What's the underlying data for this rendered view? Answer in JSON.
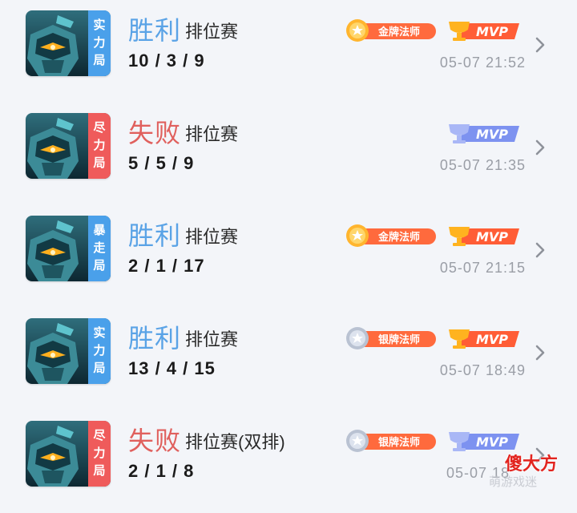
{
  "matches": [
    {
      "mode": [
        "实",
        "力",
        "局"
      ],
      "mode_color": "#4aa0ea",
      "result": "胜利",
      "result_color": "#5aa3e6",
      "game_type": "排位赛",
      "kda": "10 / 3 / 9",
      "medal": "金牌法师",
      "medal_tier": "gold",
      "mvp": "MVP",
      "mvp_tier": "gold",
      "time": "05-07 21:52"
    },
    {
      "mode": [
        "尽",
        "力",
        "局"
      ],
      "mode_color": "#ef5b5b",
      "result": "失败",
      "result_color": "#e0605d",
      "game_type": "排位赛",
      "kda": "5 / 5 / 9",
      "medal": "",
      "medal_tier": "none",
      "mvp": "MVP",
      "mvp_tier": "blue",
      "time": "05-07 21:35"
    },
    {
      "mode": [
        "暴",
        "走",
        "局"
      ],
      "mode_color": "#4aa0ea",
      "result": "胜利",
      "result_color": "#5aa3e6",
      "game_type": "排位赛",
      "kda": "2 / 1 / 17",
      "medal": "金牌法师",
      "medal_tier": "gold",
      "mvp": "MVP",
      "mvp_tier": "gold",
      "time": "05-07 21:15"
    },
    {
      "mode": [
        "实",
        "力",
        "局"
      ],
      "mode_color": "#4aa0ea",
      "result": "胜利",
      "result_color": "#5aa3e6",
      "game_type": "排位赛",
      "kda": "13 / 4 / 15",
      "medal": "银牌法师",
      "medal_tier": "silver",
      "mvp": "MVP",
      "mvp_tier": "gold",
      "time": "05-07 18:49"
    },
    {
      "mode": [
        "尽",
        "力",
        "局"
      ],
      "mode_color": "#ef5b5b",
      "result": "失败",
      "result_color": "#e0605d",
      "game_type": "排位赛(双排)",
      "kda": "2 / 1 / 8",
      "medal": "银牌法师",
      "medal_tier": "silver",
      "mvp": "MVP",
      "mvp_tier": "blue",
      "time": "05-07 18"
    }
  ],
  "icons": {
    "row_arrow": "chevron-right-icon",
    "avatar": "hero-avatar-icon",
    "medal": "medal-icon",
    "trophy": "trophy-icon"
  },
  "watermark": {
    "text": "傻大方",
    "sub": "萌游戏迷"
  }
}
